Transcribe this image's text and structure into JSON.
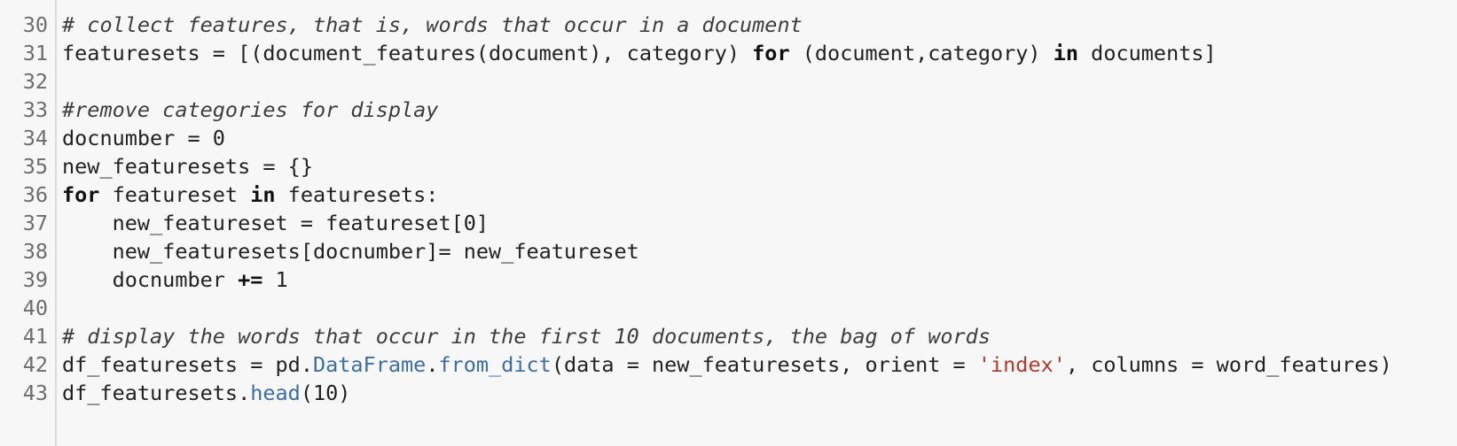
{
  "editor": {
    "lines": [
      {
        "num": "30",
        "tokens": [
          {
            "t": "# collect features, that is, words that occur in a document",
            "k": "comment"
          }
        ]
      },
      {
        "num": "31",
        "tokens": [
          {
            "t": "featuresets = [(document_features(document), category) ",
            "k": "plain"
          },
          {
            "t": "for",
            "k": "keyword"
          },
          {
            "t": " (document,category) ",
            "k": "plain"
          },
          {
            "t": "in",
            "k": "keyword"
          },
          {
            "t": " documents]",
            "k": "plain"
          }
        ]
      },
      {
        "num": "32",
        "tokens": []
      },
      {
        "num": "33",
        "tokens": [
          {
            "t": "#remove categories for display",
            "k": "comment"
          }
        ]
      },
      {
        "num": "34",
        "tokens": [
          {
            "t": "docnumber = 0",
            "k": "plain"
          }
        ]
      },
      {
        "num": "35",
        "tokens": [
          {
            "t": "new_featuresets = {}",
            "k": "plain"
          }
        ]
      },
      {
        "num": "36",
        "tokens": [
          {
            "t": "for",
            "k": "keyword"
          },
          {
            "t": " featureset ",
            "k": "plain"
          },
          {
            "t": "in",
            "k": "keyword"
          },
          {
            "t": " featuresets:",
            "k": "plain"
          }
        ]
      },
      {
        "num": "37",
        "tokens": [
          {
            "t": "    new_featureset = featureset[0]",
            "k": "plain"
          }
        ]
      },
      {
        "num": "38",
        "tokens": [
          {
            "t": "    new_featuresets[docnumber]= new_featureset",
            "k": "plain"
          }
        ]
      },
      {
        "num": "39",
        "tokens": [
          {
            "t": "    docnumber ",
            "k": "plain"
          },
          {
            "t": "+=",
            "k": "keyword"
          },
          {
            "t": " 1",
            "k": "plain"
          }
        ]
      },
      {
        "num": "40",
        "tokens": []
      },
      {
        "num": "41",
        "tokens": [
          {
            "t": "# display the words that occur in the first 10 documents, the bag of words",
            "k": "comment"
          }
        ]
      },
      {
        "num": "42",
        "tokens": [
          {
            "t": "df_featuresets = pd.",
            "k": "plain"
          },
          {
            "t": "DataFrame",
            "k": "builtin"
          },
          {
            "t": ".",
            "k": "plain"
          },
          {
            "t": "from_dict",
            "k": "builtin"
          },
          {
            "t": "(data = new_featuresets, orient = ",
            "k": "plain"
          },
          {
            "t": "'index'",
            "k": "string"
          },
          {
            "t": ", columns = word_features)",
            "k": "plain"
          }
        ]
      },
      {
        "num": "43",
        "tokens": [
          {
            "t": "df_featuresets.",
            "k": "plain"
          },
          {
            "t": "head",
            "k": "builtin"
          },
          {
            "t": "(10)",
            "k": "plain"
          }
        ]
      }
    ]
  }
}
